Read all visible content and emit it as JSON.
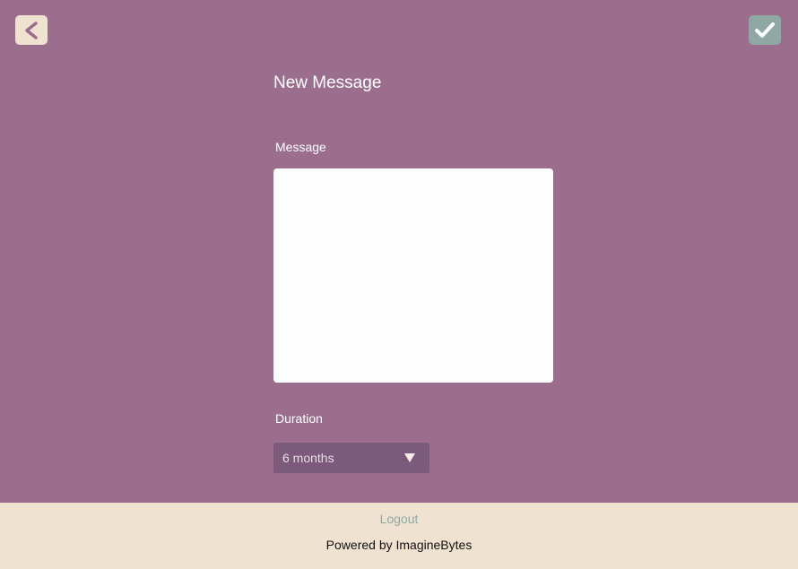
{
  "header": {
    "back_icon": "chevron-left-icon",
    "confirm_icon": "checkmark-icon",
    "title": "New Message"
  },
  "form": {
    "message_label": "Message",
    "message_value": "",
    "duration_label": "Duration",
    "duration_value": "6 months",
    "duration_icon": "caret-down-icon"
  },
  "footer": {
    "logout_label": "Logout",
    "powered_by": "Powered by ImagineBytes"
  },
  "colors": {
    "background": "#9a6e8c",
    "back_button": "#f0e2d0",
    "confirm_button": "#8fa8a4",
    "select_background": "#7b5a7c",
    "footer_background": "#f0e2d0",
    "logout_text": "#8fa8a4"
  }
}
